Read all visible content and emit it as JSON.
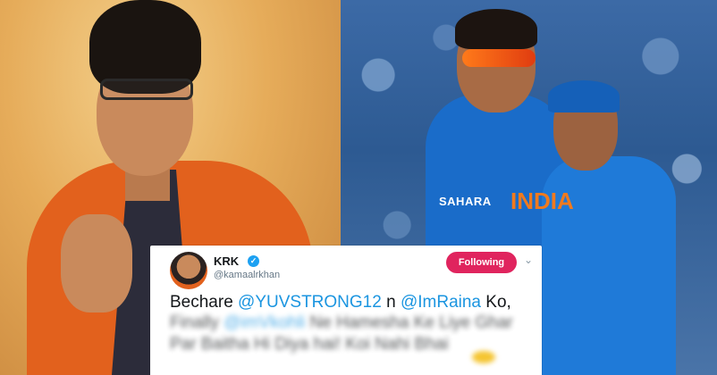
{
  "photos": {
    "left": "krk-photo",
    "right": "cricketers-photo",
    "jersey_sponsor": "SAHARA",
    "jersey_team": "INDIA"
  },
  "tweet": {
    "author_name": "KRK",
    "verified_icon": "verified-badge",
    "handle": "@kamaalrkhan",
    "follow_label": "Following",
    "more_icon": "chevron-down-icon",
    "text_prefix": "Bechare ",
    "mention_1": "@YUVSTRONG12",
    "text_mid": " n ",
    "mention_2": "@ImRaina",
    "text_suffix": " Ko,",
    "blurred_line_1_start": "Finally ",
    "blurred_mention": "@imVkohli",
    "blurred_line_1_end": " Ne Hamesha Ke Liye Ghar",
    "blurred_line_2": "Par Baitha Hi Diya hai! Koi Nahi Bhai"
  },
  "colors": {
    "follow_button": "#e0245e",
    "mention": "#1b95e0",
    "verified": "#1da1f2"
  }
}
